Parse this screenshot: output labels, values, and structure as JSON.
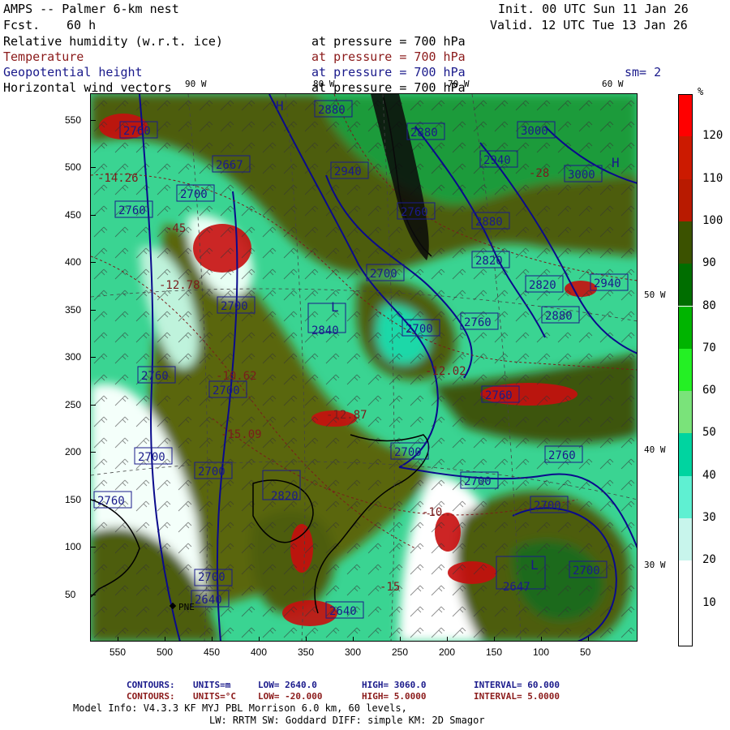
{
  "header": {
    "model_title": "AMPS -- Palmer 6-km nest",
    "forecast_label": "Fcst.",
    "forecast_hours": "60 h",
    "init": "Init. 00 UTC Sun 11 Jan 26",
    "valid": "Valid. 12 UTC Tue 13 Jan 26",
    "smoothing": "sm= 2"
  },
  "fields": [
    {
      "name": "Relative humidity (w.r.t. ice)",
      "level": "at pressure =  700 hPa",
      "color": "#000000"
    },
    {
      "name": "Temperature",
      "level": "at pressure =  700 hPa",
      "color": "#8b1a1a"
    },
    {
      "name": "Geopotential height",
      "level": "at pressure =  700 hPa",
      "color": "#1a1a8b"
    },
    {
      "name": "Horizontal wind vectors",
      "level": "at pressure =  700 hPa",
      "color": "#000000"
    }
  ],
  "colorbar": {
    "unit": "%",
    "ticks": [
      "120",
      "110",
      "100",
      "90",
      "80",
      "70",
      "60",
      "50",
      "40",
      "30",
      "20",
      "10"
    ],
    "colors": [
      "#ff0000",
      "#cc1a00",
      "#b81a00",
      "#3b5200",
      "#006e00",
      "#00b400",
      "#24f024",
      "#7ae37a",
      "#00d4a0",
      "#5ff0d2",
      "#c8f5ec",
      "#ffffff",
      "#ffffff"
    ]
  },
  "axes": {
    "x_ticks": [
      "550",
      "500",
      "450",
      "400",
      "350",
      "300",
      "250",
      "200",
      "150",
      "100",
      "50"
    ],
    "y_ticks": [
      "550",
      "500",
      "450",
      "400",
      "350",
      "300",
      "250",
      "200",
      "150",
      "100",
      "50"
    ],
    "lon_labels": [
      "90 W",
      "80 W",
      "70 W",
      "60 W",
      "50 W",
      "40 W",
      "30 W"
    ]
  },
  "map_labels": {
    "height_contours": [
      "2760",
      "2667",
      "2700",
      "2760",
      "2700",
      "2700",
      "2760",
      "2700",
      "2700",
      "2760",
      "2700",
      "2760",
      "2640",
      "2640",
      "2840",
      "2700",
      "2700",
      "2760",
      "2760",
      "2700",
      "2700",
      "2700",
      "2760",
      "2820",
      "2880",
      "2820",
      "2880",
      "2940",
      "2940",
      "3000",
      "3000",
      "2880",
      "2880",
      "2940",
      "2647",
      "2700",
      "2820"
    ],
    "temperature_labels": [
      "-14.26",
      "-45",
      "-12.78",
      "-10.62",
      "-15.09",
      "-10",
      "-15",
      "-12.02",
      "-12.87",
      "-28"
    ],
    "station": "PNE",
    "pressure_marks": [
      "H",
      "L",
      "L",
      "H"
    ]
  },
  "footer": {
    "contours_label": "CONTOURS:",
    "line1": {
      "units": "UNITS=m",
      "low": "LOW=  2640.0",
      "high": "HIGH=  3060.0",
      "interval": "INTERVAL=  60.000"
    },
    "line2": {
      "units": "UNITS=°C",
      "low": "LOW= -20.000",
      "high": "HIGH=  5.0000",
      "interval": "INTERVAL=  5.0000"
    },
    "model_info": "Model Info: V4.3.3    KF      MYJ PBL  Morrison         6.0 km,  60 levels,",
    "model_info2": "LW: RRTM SW: Goddard DIFF: simple KM: 2D Smagor"
  }
}
